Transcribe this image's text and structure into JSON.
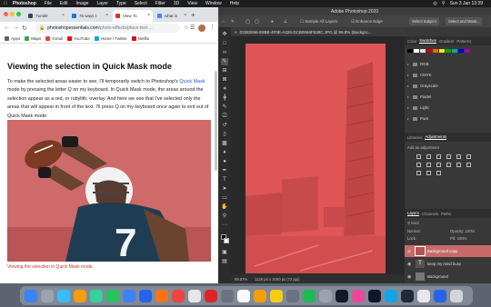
{
  "menubar": {
    "app": "Photoshop",
    "items": [
      "File",
      "Edit",
      "Image",
      "Layer",
      "Type",
      "Select",
      "Filter",
      "3D",
      "View",
      "Window",
      "Help"
    ],
    "clock": "Sun 3 Jan  13:39"
  },
  "chrome": {
    "tabs": [
      {
        "label": "Tumblr",
        "color": "#35465c"
      },
      {
        "label": "76 ways t",
        "color": "#1a73e8"
      },
      {
        "label": "View To",
        "color": "#d93025"
      },
      {
        "label": "what is",
        "color": "#4285f4"
      }
    ],
    "address": {
      "domain": "photoshopessentials.com",
      "rest": "/photo-effects/place-text-..."
    },
    "bookmarks": [
      {
        "label": "Apps",
        "color": "#5f6368"
      },
      {
        "label": "Maps",
        "color": "#34a853"
      },
      {
        "label": "Gmail",
        "color": "#ea4335"
      },
      {
        "label": "YouTube",
        "color": "#ff0000"
      },
      {
        "label": "Home / Twitter",
        "color": "#1da1f2"
      },
      {
        "label": "Netflix",
        "color": "#e50914"
      }
    ]
  },
  "article": {
    "title": "Viewing the selection in Quick Mask mode",
    "body_1": "To make the selected areas easier to see, I'll temporarily switch to Photoshop's ",
    "link": "Quick Mask",
    "body_2": " mode by pressing the letter Q on my keyboard. In Quick Mask mode, the areas around the selection appear as a red, or rubylith, overlay. And here we see that I've selected only the areas that will appear in front of the text. I'll press Q on my keyboard once again to exit out of Quick Mask mode:",
    "caption": "Viewing the selection in Quick Mask mode.",
    "jersey_number": "7"
  },
  "photoshop": {
    "title": "Adobe Photoshop 2020",
    "options": {
      "sample_all_layers": "Sample All Layers",
      "enhance_edge": "Enhance Edge",
      "select_subject": "Select Subject",
      "select_and_mask": "Select and Mask..."
    },
    "document_tab": "03282656-E8BE-4F0E-A326-DCB0656F538C.JPG @ 99.8% (Backgro...",
    "status": {
      "zoom": "99.87%",
      "size": "1125 px x 2000 px (72 ppi)"
    },
    "panel_tabs_top": [
      "Color",
      "Swatches",
      "Gradient",
      "Patterns"
    ],
    "swatch_folders": [
      "RGB",
      "CMYK",
      "Grayscale",
      "Pastel",
      "Light",
      "Pure"
    ],
    "panel_tabs_mid": [
      "Libraries",
      "Adjustments"
    ],
    "add_adjustment": "Add an adjustment",
    "panel_tabs_bottom": [
      "Layers",
      "Channels",
      "Paths"
    ],
    "layers_kind": "Kind",
    "layers_mode": "Normal",
    "opacity_label": "Opacity:",
    "opacity_value": "100%",
    "lock_label": "Lock:",
    "fill_label": "Fill:",
    "fill_value": "100%",
    "layers": [
      {
        "name": "Background copy",
        "selected": true
      },
      {
        "name": "keep my mind busy",
        "selected": false
      },
      {
        "name": "Background",
        "selected": false
      }
    ],
    "quickmask_color": "#e05555"
  },
  "dock": {
    "apps": [
      "#3b82f6",
      "#9ca3af",
      "#38bdf8",
      "#f59e0b",
      "#34d399",
      "#22c55e",
      "#3b82f6",
      "#2563eb",
      "#f97316",
      "#ef4444",
      "#e5e7eb",
      "#dc2626",
      "#6b7280",
      "#f8fafc",
      "#f59e0b",
      "#facc15",
      "#6b7280",
      "#1db954",
      "#9ca3af",
      "#111827",
      "#ec4899",
      "#0f172a",
      "#0ea5e9",
      "#1e293b",
      "#e5e7eb",
      "#2563eb",
      "#d1d5db"
    ]
  }
}
